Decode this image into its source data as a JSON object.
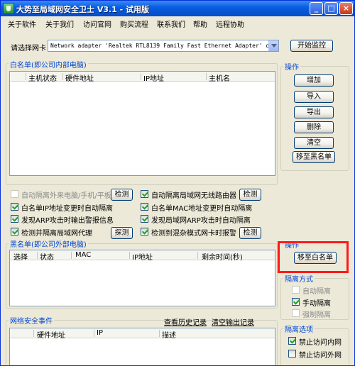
{
  "window": {
    "title": "大势至局域网安全卫士 V3.1 - 试用版",
    "controls": [
      "_",
      "□",
      "×"
    ]
  },
  "menu": [
    "关于软件",
    "关于我们",
    "访问官网",
    "购买流程",
    "联系我们",
    "帮助",
    "远程协助"
  ],
  "adapter": {
    "label": "请选择网卡",
    "value": "Network adapter 'Realtek RTL8139 Family Fast Ethernet Adapter' on",
    "start_button": "开始监控"
  },
  "whitelist": {
    "title": "白名单(即公司内部电脑)",
    "columns": [
      "主机状态",
      "硬件地址",
      "IP地址",
      "主机名"
    ],
    "rows": []
  },
  "ops1": {
    "title": "操作",
    "buttons": [
      "增加",
      "导入",
      "导出",
      "删除",
      "清空",
      "移至黑名单"
    ]
  },
  "options": [
    {
      "label": "自动隔离外来电脑/手机/平板",
      "checked": false,
      "disabled": true
    },
    {
      "label": "检测",
      "is_button": true
    },
    {
      "label": "自动隔离局域网无线路由器",
      "checked": true
    },
    {
      "label": "检测",
      "is_button": true
    },
    {
      "label": "白名单IP地址变更时自动隔离",
      "checked": true
    },
    {
      "label": "白名单MAC地址变更时自动隔离",
      "checked": true
    },
    {
      "label": "发现ARP攻击时输出警报信息",
      "checked": true
    },
    {
      "label": "发现局域网ARP攻击时自动隔离",
      "checked": true
    },
    {
      "label": "检测并隔离局域网代理",
      "checked": true
    },
    {
      "label": "探测",
      "is_button": true
    },
    {
      "label": "检测到混杂模式网卡时报警",
      "checked": true
    },
    {
      "label": "检测",
      "is_button": true
    }
  ],
  "blacklist": {
    "title": "黑名单(即公司外部电脑)",
    "columns": [
      "选择",
      "状态",
      "MAC",
      "IP地址",
      "剩余时间(秒)"
    ],
    "rows": []
  },
  "ops2": {
    "title": "操作",
    "button": "移至白名单"
  },
  "isolation_mode": {
    "title": "隔离方式",
    "items": [
      {
        "label": "自动隔离",
        "checked": false
      },
      {
        "label": "手动隔离",
        "checked": true
      },
      {
        "label": "强制隔离",
        "checked": false
      }
    ]
  },
  "events": {
    "title": "网络安全事件",
    "history_link": "查看历史记录",
    "clear_link": "清空输出记录",
    "columns": [
      "硬件地址",
      "IP",
      "描述"
    ]
  },
  "isolation_options": {
    "title": "隔离选项",
    "items": [
      {
        "label": "禁止访问内网",
        "checked": true
      },
      {
        "label": "禁止访问外网",
        "checked": false
      }
    ]
  },
  "colors": {
    "group_title": "#0046d5",
    "highlight": "#ff1a1a"
  }
}
